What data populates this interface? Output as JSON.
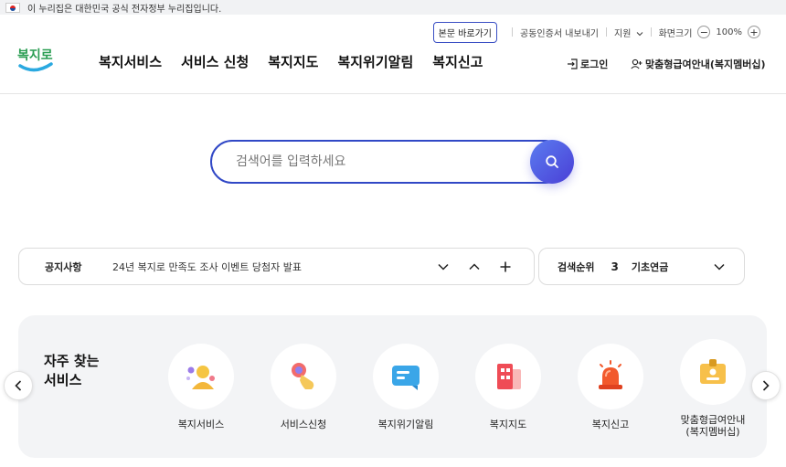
{
  "gov_banner": {
    "text": "이 누리집은 대한민국 공식 전자정부 누리집입니다."
  },
  "utility": {
    "skip_label": "본문 바로가기",
    "cert_label": "공동인증서 내보내기",
    "support_label": "지원",
    "font_size_label": "화면크기",
    "zoom_minus": "−",
    "zoom_value": "100%",
    "zoom_plus": "+"
  },
  "logo": {
    "text": "복지로"
  },
  "nav": {
    "items": [
      {
        "label": "복지서비스"
      },
      {
        "label": "서비스 신청"
      },
      {
        "label": "복지지도"
      },
      {
        "label": "복지위기알림"
      },
      {
        "label": "복지신고"
      }
    ]
  },
  "account": {
    "login_label": "로그인",
    "member_label": "맞춤형급여안내(복지멤버십)"
  },
  "search": {
    "placeholder": "검색어를 입력하세요"
  },
  "notice": {
    "label": "공지사항",
    "text": "24년 복지로 만족도 조사 이벤트 당첨자 발표"
  },
  "ranking": {
    "label": "검색순위",
    "rank": "3",
    "term": "기초연금"
  },
  "services": {
    "title_line1": "자주 찾는",
    "title_line2": "서비스",
    "items": [
      {
        "label": "복지서비스",
        "icon": "people-icon"
      },
      {
        "label": "서비스신청",
        "icon": "touch-icon"
      },
      {
        "label": "복지위기알림",
        "icon": "message-icon"
      },
      {
        "label": "복지지도",
        "icon": "building-icon"
      },
      {
        "label": "복지신고",
        "icon": "siren-icon"
      },
      {
        "label": "맞춤형급여안내\n(복지멤버십)",
        "icon": "id-card-icon"
      }
    ]
  },
  "colors": {
    "accent": "#3148c6",
    "logo_green": "#2a9d52",
    "search_gradient_start": "#5b7cf0",
    "search_gradient_end": "#4a3fd6",
    "panel_bg": "#f3f4f6"
  }
}
